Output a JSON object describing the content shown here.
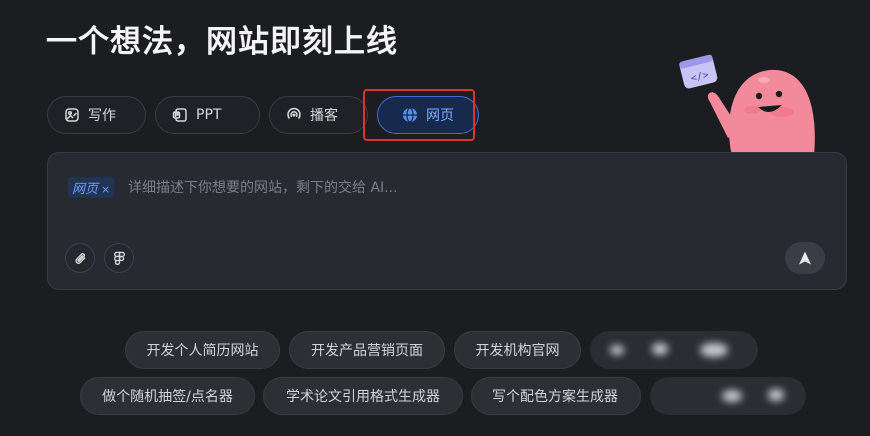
{
  "headline": "一个想法，网站即刻上线",
  "tabs": [
    {
      "label": "写作",
      "icon": "image-edit-icon"
    },
    {
      "label": "PPT",
      "icon": "presentation-icon"
    },
    {
      "label": "播客",
      "icon": "podcast-icon"
    },
    {
      "label": "网页",
      "icon": "globe-icon",
      "active": true
    }
  ],
  "prompt": {
    "chip_label": "网页",
    "chip_close": "×",
    "placeholder": "详细描述下你想要的网站，剩下的交给 AI..."
  },
  "suggestions_row1": [
    "开发个人简历网站",
    "开发产品营销页面",
    "开发机构官网"
  ],
  "suggestions_row2": [
    "做个随机抽签/点名器",
    "学术论文引用格式生成器",
    "写个配色方案生成器"
  ],
  "colors": {
    "background": "#1c1d20",
    "active_tab_bg": "#172a4e",
    "active_tab_text": "#7eacff",
    "highlight": "#e0322c",
    "mascot": "#f28a9b"
  }
}
